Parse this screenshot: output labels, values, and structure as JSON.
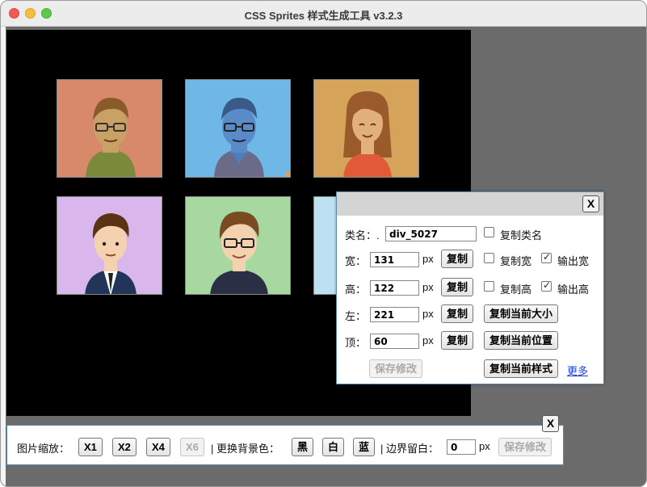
{
  "window": {
    "title": "CSS Sprites 样式生成工具 v3.2.3"
  },
  "sprites": [
    {
      "name": "avatar-man-glasses-orange",
      "bg": "#d8896a"
    },
    {
      "name": "avatar-man-glasses-blue",
      "bg": "#6fb7e6"
    },
    {
      "name": "avatar-woman-orange",
      "bg": "#d6a35a"
    },
    {
      "name": "avatar-man-suit-purple",
      "bg": "#d9b6ec"
    },
    {
      "name": "avatar-man-glasses-green",
      "bg": "#a6d8a0"
    },
    {
      "name": "avatar-partial-lightblue",
      "bg": "#bde0f2"
    }
  ],
  "dialog": {
    "close": "X",
    "class_label": "类名：.",
    "class_value": "div_5027",
    "copy_class": "复制类名",
    "width_label": "宽：",
    "width_value": "131",
    "height_label": "高：",
    "height_value": "122",
    "left_label": "左：",
    "left_value": "221",
    "top_label": "顶：",
    "top_value": "60",
    "px": "px",
    "copy": "复制",
    "copy_width": "复制宽",
    "output_width": "输出宽",
    "copy_height": "复制高",
    "output_height": "输出高",
    "copy_size": "复制当前大小",
    "copy_position": "复制当前位置",
    "save": "保存修改",
    "copy_style": "复制当前样式",
    "more": "更多",
    "checks": {
      "copy_class": false,
      "copy_width": false,
      "output_width": true,
      "copy_height": false,
      "output_height": true
    }
  },
  "toolbar": {
    "close": "X",
    "zoom_label": "图片缩放：",
    "x1": "X1",
    "x2": "X2",
    "x4": "X4",
    "x6": "X6",
    "bg_label": "| 更换背景色：",
    "black": "黑",
    "white": "白",
    "blue": "蓝",
    "margin_label": "| 边界留白：",
    "margin_value": "0",
    "px": "px",
    "save": "保存修改"
  }
}
